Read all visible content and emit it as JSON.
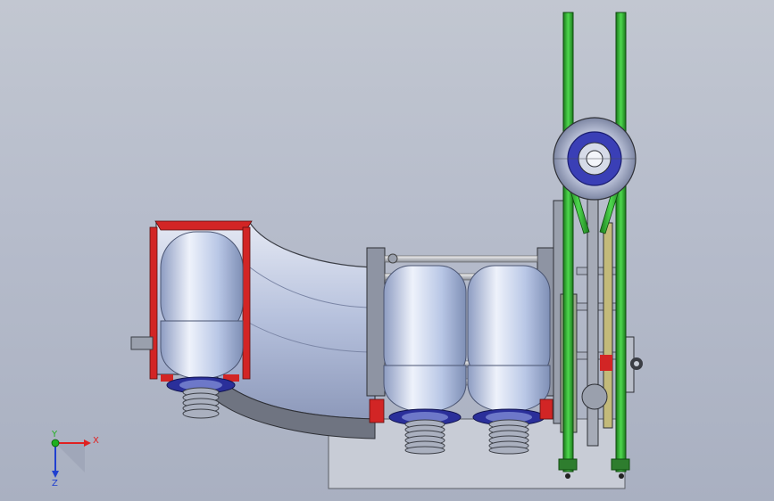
{
  "viewport": {
    "background_top": "#c2c7d1",
    "background_bottom": "#a9b0c1"
  },
  "model": {
    "colors": {
      "bottle_body": "#b9c7e6",
      "bottle_highlight": "#eef2fb",
      "bottle_shadow": "#7e8fb5",
      "cap_ring": "#2a2f9a",
      "spring": "#aab0bf",
      "cut_section": "#d22525",
      "frame_green": "#2fb52f",
      "frame_green_dark": "#1b7a1b",
      "base_plate": "#c8ccd6",
      "hub_blue": "#3a3fb6"
    }
  },
  "triad": {
    "x_label": "X",
    "y_label": "Y",
    "z_label": "Z",
    "x_color": "#e02020",
    "y_color": "#20b020",
    "z_color": "#2040d0"
  }
}
